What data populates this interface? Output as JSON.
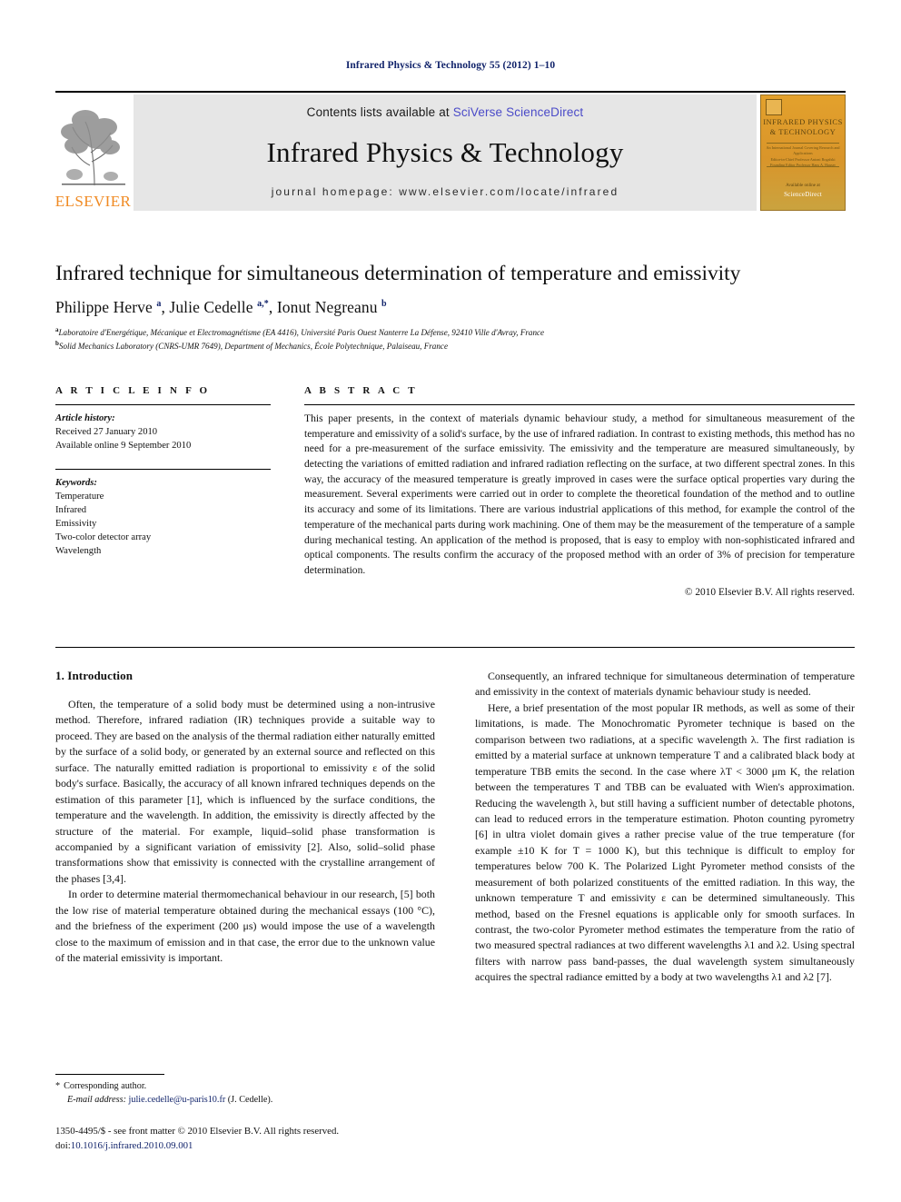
{
  "running_citation": "Infrared Physics & Technology 55 (2012) 1–10",
  "masthead": {
    "publisher_wordmark": "ELSEVIER",
    "contents_prefix": "Contents lists available at ",
    "contents_link": "SciVerse ScienceDirect",
    "journal_name": "Infrared Physics & Technology",
    "homepage": "journal homepage: www.elsevier.com/locate/infrared",
    "cover": {
      "title_line1": "INFRARED PHYSICS",
      "title_line2": "& TECHNOLOGY",
      "sub_line1": "An International Journal Covering Research and Applications",
      "sub_line2": "Editor-in-Chief  Professor Antoni Rogalski",
      "sub_line3": "Founding Editor  Professor Hans A. Hauser",
      "foot_label": "Available online at",
      "foot_brand": "ScienceDirect"
    },
    "accent_orange": "#f08a23",
    "link_blue": "#4a4ac8",
    "citation_blue": "#12246b",
    "panel_grey": "#e6e6e6"
  },
  "article": {
    "title": "Infrared technique for simultaneous determination of temperature and emissivity",
    "authors_html": "Philippe Herve <sup>a</sup>, Julie Cedelle <sup>a,*</sup>, Ionut Negreanu <sup>b</sup>",
    "affiliation_a": "Laboratoire d'Energétique, Mécanique et Electromagnétisme (EA 4416), Université Paris Ouest Nanterre La Défense, 92410 Ville d'Avray, France",
    "affiliation_b": "Solid Mechanics Laboratory (CNRS-UMR 7649), Department of Mechanics, École Polytechnique, Palaiseau, France"
  },
  "article_info": {
    "heading": "A R T I C L E    I N F O",
    "history_label": "Article history:",
    "received": "Received 27 January 2010",
    "available_online": "Available online 9 September 2010",
    "keywords_label": "Keywords:",
    "keywords": [
      "Temperature",
      "Infrared",
      "Emissivity",
      "Two-color detector array",
      "Wavelength"
    ]
  },
  "abstract": {
    "heading": "A B S T R A C T",
    "text": "This paper presents, in the context of materials dynamic behaviour study, a method for simultaneous measurement of the temperature and emissivity of a solid's surface, by the use of infrared radiation. In contrast to existing methods, this method has no need for a pre-measurement of the surface emissivity. The emissivity and the temperature are measured simultaneously, by detecting the variations of emitted radiation and infrared radiation reflecting on the surface, at two different spectral zones. In this way, the accuracy of the measured temperature is greatly improved in cases were the surface optical properties vary during the measurement. Several experiments were carried out in order to complete the theoretical foundation of the method and to outline its accuracy and some of its limitations. There are various industrial applications of this method, for example the control of the temperature of the mechanical parts during work machining. One of them may be the measurement of the temperature of a sample during mechanical testing. An application of the method is proposed, that is easy to employ with non-sophisticated infrared and optical components. The results confirm the accuracy of the proposed method with an order of 3% of precision for temperature determination.",
    "copyright": "© 2010 Elsevier B.V. All rights reserved."
  },
  "body": {
    "section_heading": "1. Introduction",
    "left_paragraphs": [
      "Often, the temperature of a solid body must be determined using a non-intrusive method. Therefore, infrared radiation (IR) techniques provide a suitable way to proceed. They are based on the analysis of the thermal radiation either naturally emitted by the surface of a solid body, or generated by an external source and reflected on this surface. The naturally emitted radiation is proportional to emissivity ε of the solid body's surface. Basically, the accuracy of all known infrared techniques depends on the estimation of this parameter [1], which is influenced by the surface conditions, the temperature and the wavelength. In addition, the emissivity is directly affected by the structure of the material. For example, liquid–solid phase transformation is accompanied by a significant variation of emissivity [2]. Also, solid–solid phase transformations show that emissivity is connected with the crystalline arrangement of the phases [3,4].",
      "In order to determine material thermomechanical behaviour in our research, [5] both the low rise of material temperature obtained during the mechanical essays (100 °C), and the briefness of the experiment (200 μs) would impose the use of a wavelength close to the maximum of emission and in that case, the error due to the unknown value of the material emissivity is important."
    ],
    "right_paragraphs": [
      "Consequently, an infrared technique for simultaneous determination of temperature and emissivity in the context of materials dynamic behaviour study is needed.",
      "Here, a brief presentation of the most popular IR methods, as well as some of their limitations, is made. The Monochromatic Pyrometer technique is based on the comparison between two radiations, at a specific wavelength λ. The first radiation is emitted by a material surface at unknown temperature T and a calibrated black body at temperature TBB emits the second. In the case where λT < 3000 μm K, the relation between the temperatures T and TBB can be evaluated with Wien's approximation. Reducing the wavelength λ, but still having a sufficient number of detectable photons, can lead to reduced errors in the temperature estimation. Photon counting pyrometry [6] in ultra violet domain gives a rather precise value of the true temperature (for example ±10 K for T = 1000 K), but this technique is difficult to employ for temperatures below 700 K. The Polarized Light Pyrometer method consists of the measurement of both polarized constituents of the emitted radiation. In this way, the unknown temperature T and emissivity ε can be determined simultaneously. This method, based on the Fresnel equations is applicable only for smooth surfaces. In contrast, the two-color Pyrometer method estimates the temperature from the ratio of two measured spectral radiances at two different wavelengths λ1 and λ2. Using spectral filters with narrow pass band-passes, the dual wavelength system simultaneously acquires the spectral radiance emitted by a body at two wavelengths λ1 and λ2 [7]."
    ]
  },
  "footer": {
    "corresponding_marker": "*",
    "corresponding_label": "Corresponding author.",
    "email_label": "E-mail address:",
    "email": "julie.cedelle@u-paris10.fr",
    "email_owner": "(J. Cedelle).",
    "imprint_line": "1350-4495/$ - see front matter © 2010 Elsevier B.V. All rights reserved.",
    "doi_label": "doi:",
    "doi": "10.1016/j.infrared.2010.09.001"
  }
}
